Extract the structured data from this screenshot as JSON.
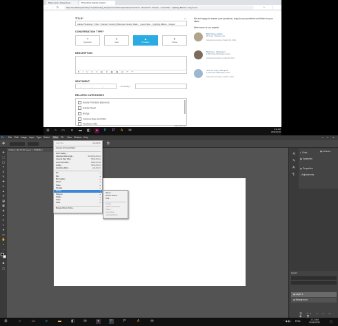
{
  "browser": {
    "tabs": [
      "Filter menu: Greyed out...",
      "Photoshop Family Custom..."
    ],
    "url": "https://feedback.photoshop.com/photoshop_family/conversations/photoshop/new?ms=...Render/Cl...Clouds+...Lens+Flare...Lighting+Effects+..Greyed out",
    "nav": {
      "back": "←",
      "forward": "→",
      "reload": "↻"
    },
    "form": {
      "title_label": "TITLE*",
      "title_value": "Adobe Photoshop > Filter > Render: Clouds | Difference Clouds | Flash... | Lens Flare... | Lighting Effects... Greyed",
      "char_count": "24",
      "ctype_label": "CONVERSATION TYPE*",
      "ctypes": [
        {
          "label": "Question",
          "icon": "?"
        },
        {
          "label": "Idea",
          "icon": "✶"
        },
        {
          "label": "Problem",
          "icon": "▲"
        },
        {
          "label": "Praise",
          "icon": "♥"
        }
      ],
      "desc_label": "DESCRIPTION",
      "sentiment_label": "SENTIMENT",
      "sentiment_note": "- am feeling -",
      "related_label": "RELATED CATEGORIES",
      "categories": [
        "Adobe Premiere Elements",
        "Adobe Revel",
        "Bridge",
        "Camera Raw and DNG",
        "Feedback Site"
      ],
      "footer_note": "Help with Post"
    },
    "sidebar": {
      "intro": "We are happy to answer your questions, reply to your problems and listen to your ideas.",
      "meet": "Meet some of our experts:",
      "experts": [
        {
          "name": "Bob Gago, Adobe",
          "stats": "85 Posts   1 Replies Like",
          "last": "Joined community on March 30, 2011"
        },
        {
          "name": "Bob Fore, Champion",
          "stats": "1,582 Posts   540 Replies Likes",
          "last": "Joined community on April 26, 2011"
        },
        {
          "name": "John B. Citty, Champion",
          "stats": "1,183 Posts   598 Replies Likes",
          "last": "Joined community on April 5, 2013"
        }
      ]
    }
  },
  "taskbar_top": {
    "time": "1:11 AM",
    "date": "2018/02/20"
  },
  "photoshop": {
    "menu_items": [
      "Ps",
      "File",
      "Edit",
      "Image",
      "Layer",
      "Type",
      "Select",
      "Filter",
      "3D",
      "View",
      "Window",
      "Help"
    ],
    "doc_tab": "Untitled-1 @ 33.3% (Layer 1, RGB/8#) ×",
    "filter_menu": [
      {
        "label": "Last Filter",
        "shortcut": "Alt+Ctrl+F",
        "dim": true
      },
      {
        "sep": true
      },
      {
        "label": "Convert for Smart Filters"
      },
      {
        "sep": true
      },
      {
        "label": "Filter Gallery..."
      },
      {
        "label": "Adaptive Wide Angle...",
        "shortcut": "Alt+Shift+Ctrl+A"
      },
      {
        "label": "Camera Raw Filter...",
        "shortcut": "Shift+Ctrl+A"
      },
      {
        "label": "Lens Correction...",
        "shortcut": "Shift+Ctrl+R"
      },
      {
        "label": "Liquify...",
        "shortcut": "Shift+Ctrl+X"
      },
      {
        "label": "Vanishing Point...",
        "shortcut": "Alt+Ctrl+V"
      },
      {
        "sep": true
      },
      {
        "label": "3D",
        "arrow": true
      },
      {
        "label": "Blur",
        "arrow": true
      },
      {
        "label": "Blur Gallery",
        "arrow": true
      },
      {
        "label": "Distort",
        "arrow": true
      },
      {
        "label": "Noise",
        "arrow": true
      },
      {
        "label": "Pixelate",
        "arrow": true
      },
      {
        "label": "Render",
        "arrow": true,
        "hl": true
      },
      {
        "label": "Sharpen",
        "arrow": true
      },
      {
        "label": "Stylize",
        "arrow": true
      },
      {
        "label": "Video",
        "arrow": true
      },
      {
        "label": "Other",
        "arrow": true
      },
      {
        "sep": true
      },
      {
        "label": "Browse Filters Online..."
      }
    ],
    "render_menu": [
      {
        "label": "Flame..."
      },
      {
        "label": "Picture Frame..."
      },
      {
        "label": "Tree..."
      },
      {
        "sep": true
      },
      {
        "label": "Clouds",
        "dim": true
      },
      {
        "label": "Difference Clouds",
        "dim": true
      },
      {
        "label": "Fibers...",
        "dim": true
      },
      {
        "label": "Lens Flare...",
        "dim": true
      },
      {
        "label": "Lighting Effects...",
        "dim": true
      }
    ],
    "dock": [
      "Color",
      "Swatches",
      "Properties",
      "Adjustments"
    ],
    "layers_title": "Layers",
    "layers": [
      "Layer 1",
      "Background"
    ]
  },
  "taskbar_bottom": {
    "time": "1:11 AM",
    "date": "2018/02/20",
    "lang": "ENG"
  },
  "colors": {
    "accent": "#2aabe2",
    "ps_bg": "#535353",
    "menu_hl": "#3a86d8"
  }
}
